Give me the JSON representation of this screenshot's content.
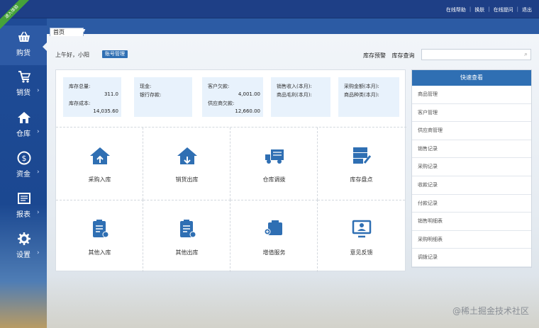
{
  "header": {
    "badge": "进入体验",
    "links": [
      "在线帮助",
      "换肤",
      "在线提问",
      "退出"
    ]
  },
  "nav": [
    {
      "label": "购货",
      "icon": "basket-icon",
      "active": true
    },
    {
      "label": "销货",
      "icon": "cart-icon"
    },
    {
      "label": "仓库",
      "icon": "home-icon"
    },
    {
      "label": "资金",
      "icon": "dollar-icon"
    },
    {
      "label": "报表",
      "icon": "report-icon"
    },
    {
      "label": "设置",
      "icon": "gear-icon"
    }
  ],
  "tabs": {
    "home": "首页"
  },
  "main": {
    "greeting": "上午好，小阳",
    "account_btn": "账号管理",
    "stock_warning": "库存预警",
    "stock_query": "库存查询"
  },
  "stats": {
    "inv_total_label": "库存总量:",
    "inv_total": "311.0",
    "inv_cost_label": "库存成本:",
    "inv_cost": "14,035.60",
    "cash_label": "现金:",
    "bank_label": "银行存款:",
    "cust_owed_label": "客户欠款:",
    "cust_owed": "4,001.00",
    "supplier_owed_label": "供应商欠款:",
    "supplier_owed": "12,660.00",
    "sales_income_label": "销售收入(本月):",
    "gross_profit_label": "商品毛利(本月):",
    "purchase_amt_label": "采购金额(本月):",
    "product_type_label": "商品种类(本月):"
  },
  "tiles": [
    {
      "label": "采购入库",
      "icon": "purchase-in-icon"
    },
    {
      "label": "销货出库",
      "icon": "sales-out-icon"
    },
    {
      "label": "仓库调拨",
      "icon": "truck-icon"
    },
    {
      "label": "库存盘点",
      "icon": "inventory-check-icon"
    },
    {
      "label": "其他入库",
      "icon": "other-in-icon"
    },
    {
      "label": "其他出库",
      "icon": "other-out-icon"
    },
    {
      "label": "增值服务",
      "icon": "service-icon"
    },
    {
      "label": "意见反馈",
      "icon": "feedback-icon"
    }
  ],
  "quick": {
    "title": "快速查看",
    "items": [
      "商品管理",
      "客户管理",
      "供应商管理",
      "销售记录",
      "采购记录",
      "收款记录",
      "付款记录",
      "销售明细表",
      "采购明细表",
      "调拨记录"
    ]
  },
  "watermark": "@稀土掘金技术社区",
  "colors": {
    "topbar": "#1e3f86",
    "nav": "#1f4b96",
    "accent": "#2f6fb3",
    "icon": "#2f6fb3"
  }
}
